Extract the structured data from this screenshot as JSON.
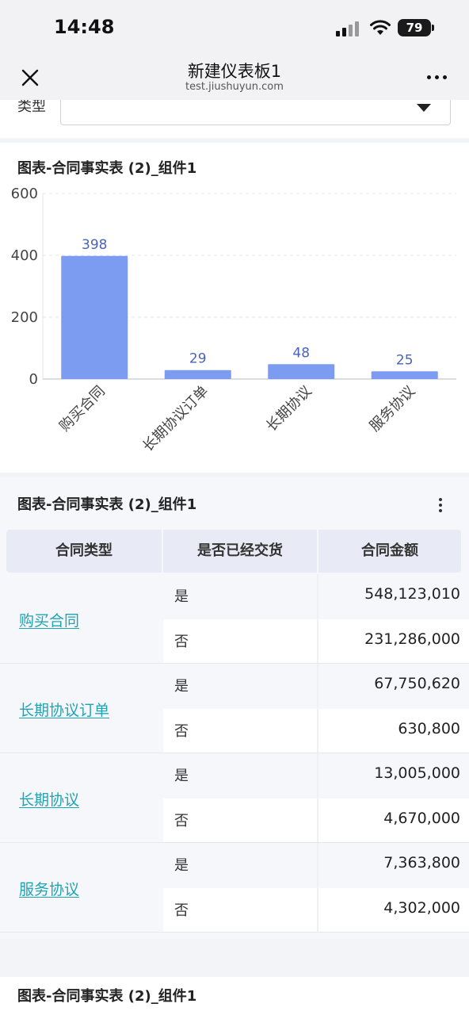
{
  "status_bar": {
    "time": "14:48",
    "battery": "79"
  },
  "nav": {
    "title": "新建仪表板1",
    "subtitle": "test.jiushuyun.com"
  },
  "filter": {
    "label": "类型",
    "value": ""
  },
  "chart_card": {
    "title": "图表-合同事实表 (2)_组件1"
  },
  "chart_data": {
    "type": "bar",
    "categories": [
      "购买合同",
      "长期协议订单",
      "长期协议",
      "服务协议"
    ],
    "values": [
      398,
      29,
      48,
      25
    ],
    "y_ticks": [
      "0",
      "200",
      "400",
      "600"
    ],
    "ylim": [
      0,
      600
    ],
    "grid": true,
    "bar_color": "#7b9cf0",
    "label_color": "#4a63b8"
  },
  "table_card": {
    "title": "图表-合同事实表 (2)_组件1",
    "headers": [
      "合同类型",
      "是否已经交货",
      "合同金额"
    ],
    "groups": [
      {
        "type": "购买合同",
        "rows": [
          {
            "delivered": "是",
            "amount": "548,123,010"
          },
          {
            "delivered": "否",
            "amount": "231,286,000"
          }
        ]
      },
      {
        "type": "长期协议订单",
        "rows": [
          {
            "delivered": "是",
            "amount": "67,750,620"
          },
          {
            "delivered": "否",
            "amount": "630,800"
          }
        ]
      },
      {
        "type": "长期协议",
        "rows": [
          {
            "delivered": "是",
            "amount": "13,005,000"
          },
          {
            "delivered": "否",
            "amount": "4,670,000"
          }
        ]
      },
      {
        "type": "服务协议",
        "rows": [
          {
            "delivered": "是",
            "amount": "7,363,800"
          },
          {
            "delivered": "否",
            "amount": "4,302,000"
          }
        ]
      }
    ],
    "link_color": "#20a4b3"
  },
  "next_card": {
    "title": "图表-合同事实表 (2)_组件1"
  }
}
